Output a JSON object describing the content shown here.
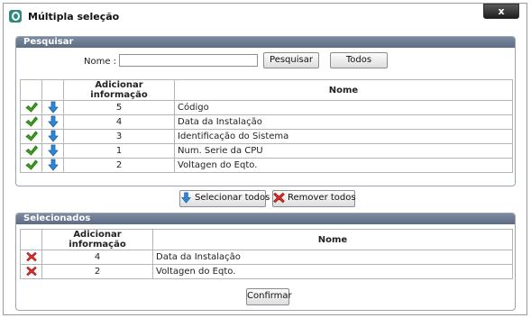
{
  "window": {
    "title": "Múltipla seleção",
    "close_label": "x"
  },
  "search": {
    "header": "Pesquisar",
    "name_label": "Nome :",
    "name_value": "",
    "search_button": "Pesquisar",
    "all_button": "Todos",
    "columns": [
      "Adicionar informação",
      "Nome"
    ],
    "rows": [
      {
        "code": "5",
        "name": "Código"
      },
      {
        "code": "4",
        "name": "Data da Instalação"
      },
      {
        "code": "3",
        "name": "Identificação do Sistema"
      },
      {
        "code": "1",
        "name": "Num. Serie da CPU"
      },
      {
        "code": "2",
        "name": "Voltagen do Eqto."
      }
    ]
  },
  "actions": {
    "select_all": "Selecionar todos",
    "remove_all": "Remover todos"
  },
  "selected": {
    "header": "Selecionados",
    "columns": [
      "Adicionar informação",
      "Nome"
    ],
    "rows": [
      {
        "code": "4",
        "name": "Data da Instalação"
      },
      {
        "code": "2",
        "name": "Voltagen do Eqto."
      }
    ]
  },
  "confirm_button": "Confirmar",
  "colors": {
    "header_bg": "#6b7a90",
    "check_green": "#3aa11e",
    "arrow_blue": "#2f86d6",
    "remove_red": "#d42a2a"
  },
  "icons": {
    "add": "green-check-icon",
    "move": "blue-down-arrow-icon",
    "remove": "red-x-icon"
  }
}
